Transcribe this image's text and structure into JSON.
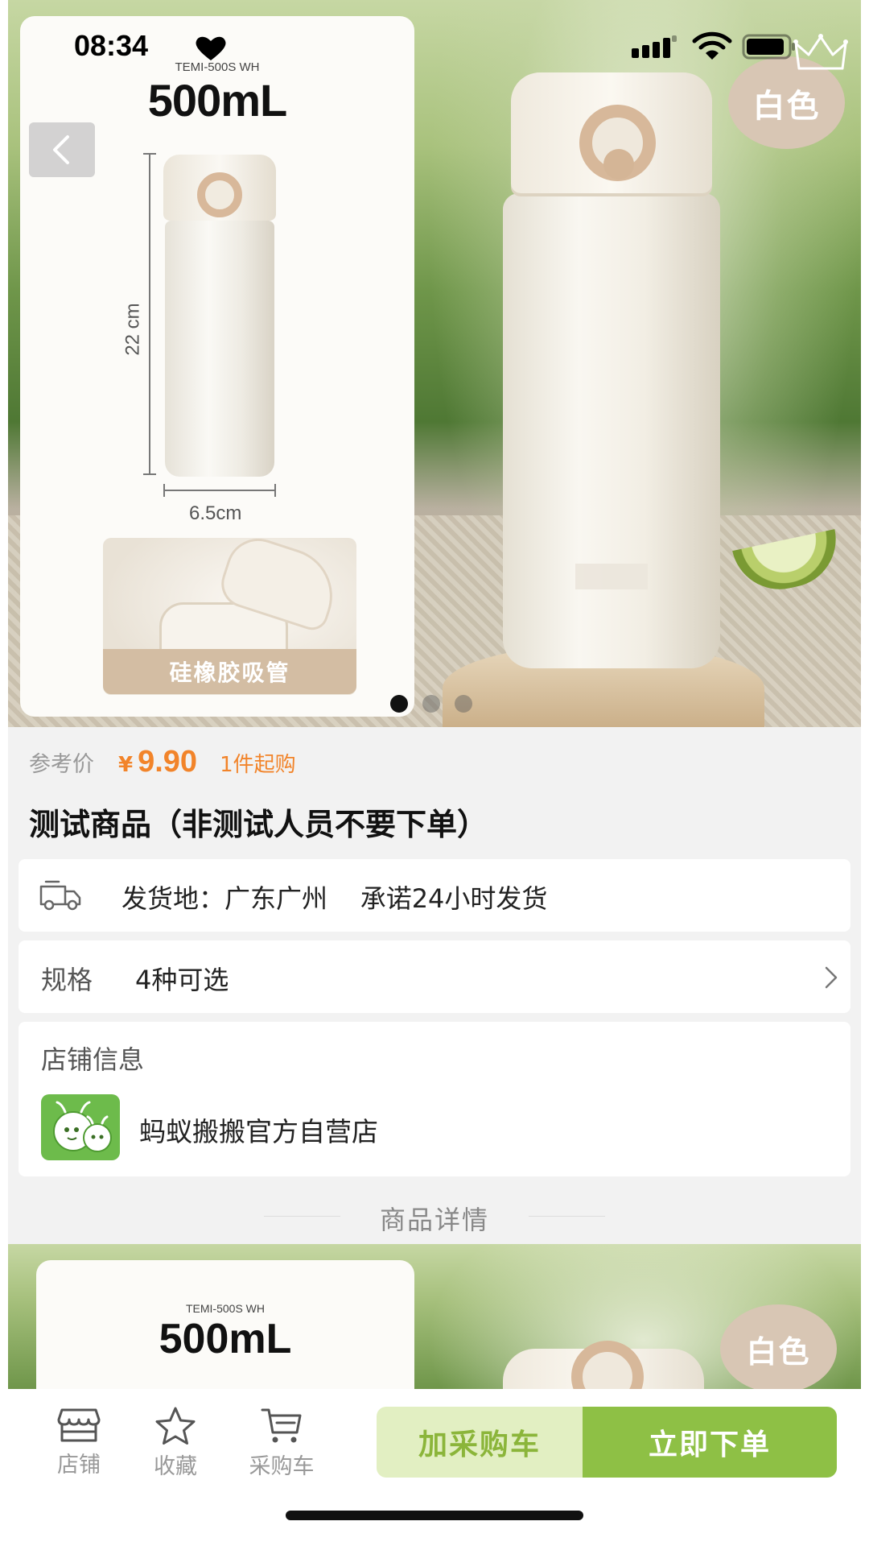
{
  "status_bar": {
    "time": "08:34"
  },
  "hero": {
    "model_text": "TEMI-500S WH",
    "volume_text": "500mL",
    "height_dim": "22 cm",
    "width_dim": "6.5cm",
    "straw_label": "硅橡胶吸管",
    "color_badge": "白色",
    "slide_count": 3,
    "active_slide": 1
  },
  "price": {
    "label": "参考价",
    "symbol": "¥",
    "value": "9.90",
    "moq": "1件起购"
  },
  "product": {
    "title": "测试商品（非测试人员不要下单）"
  },
  "shipping": {
    "text": "发货地：广东广州    承诺24小时发货"
  },
  "spec": {
    "label": "规格",
    "value": "4种可选"
  },
  "store": {
    "heading": "店铺信息",
    "name": "蚂蚁搬搬官方自营店"
  },
  "details": {
    "label": "商品详情"
  },
  "detail_image": {
    "model_text": "TEMI-500S WH",
    "volume_text": "500mL",
    "color_badge": "白色"
  },
  "bottom_nav": {
    "store_label": "店铺",
    "favorite_label": "收藏",
    "cart_label": "采购车",
    "add_cart_label": "加采购车",
    "buy_now_label": "立即下单"
  },
  "colors": {
    "price_orange": "#f2842a",
    "primary_green": "#8ec045",
    "light_green": "#e2efc2",
    "light_green_text": "#8bb53a",
    "page_bg": "#f2f2f2"
  }
}
